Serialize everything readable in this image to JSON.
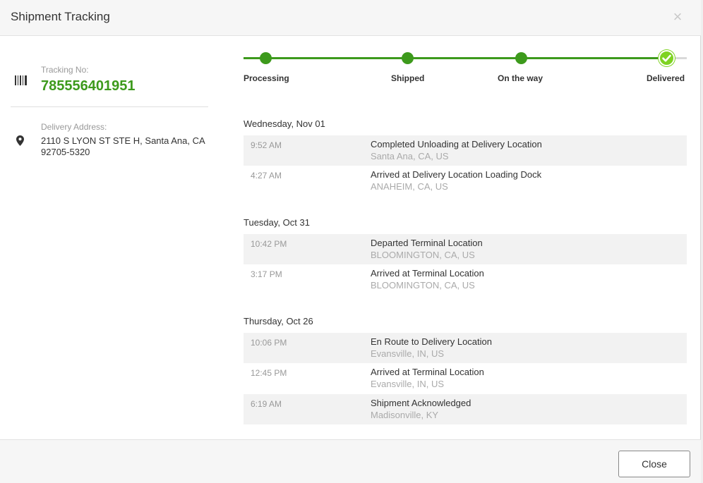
{
  "header": {
    "title": "Shipment Tracking",
    "close_icon": "×"
  },
  "shipment": {
    "tracking_label": "Tracking No:",
    "tracking_number": "785556401951",
    "address_label": "Delivery Address:",
    "address_line1": "2110 S LYON ST STE H, Santa Ana, CA",
    "address_line2": "92705-5320"
  },
  "progress": {
    "steps": [
      {
        "label": "Processing",
        "done": true
      },
      {
        "label": "Shipped",
        "done": true
      },
      {
        "label": "On the way",
        "done": true
      },
      {
        "label": "Delivered",
        "done": true,
        "current": true
      }
    ],
    "colors": {
      "active": "#3d9a1c",
      "current": "#7ed321",
      "inactive": "#d9d9d9"
    }
  },
  "events": [
    {
      "day": "Wednesday, Nov 01",
      "items": [
        {
          "time": "9:52 AM",
          "event": "Completed Unloading at Delivery Location",
          "location": "Santa Ana, CA, US"
        },
        {
          "time": "4:27 AM",
          "event": "Arrived at Delivery Location Loading Dock",
          "location": "ANAHEIM, CA, US"
        }
      ]
    },
    {
      "day": "Tuesday, Oct 31",
      "items": [
        {
          "time": "10:42 PM",
          "event": "Departed Terminal Location",
          "location": "BLOOMINGTON, CA, US"
        },
        {
          "time": "3:17 PM",
          "event": "Arrived at Terminal Location",
          "location": "BLOOMINGTON, CA, US"
        }
      ]
    },
    {
      "day": "Thursday, Oct 26",
      "items": [
        {
          "time": "10:06 PM",
          "event": "En Route to Delivery Location",
          "location": "Evansville, IN, US"
        },
        {
          "time": "12:45 PM",
          "event": "Arrived at Terminal Location",
          "location": "Evansville, IN, US"
        },
        {
          "time": "6:19 AM",
          "event": "Shipment Acknowledged",
          "location": "Madisonville, KY"
        }
      ]
    }
  ],
  "footer": {
    "close_label": "Close"
  },
  "icons": {
    "barcode": "barcode-icon",
    "location": "map-pin-icon",
    "check": "check-icon",
    "close": "close-icon"
  }
}
